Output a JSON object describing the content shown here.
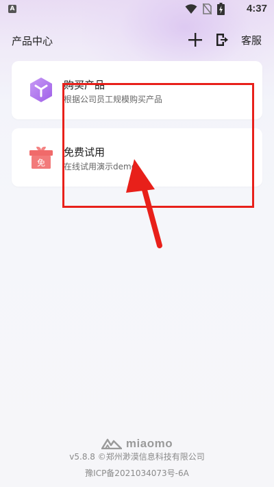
{
  "status_bar": {
    "app_icon_letter": "A",
    "time": "4:37"
  },
  "header": {
    "title": "产品中心",
    "service_label": "客服"
  },
  "cards": [
    {
      "title": "购买产品",
      "description": "根据公司员工规模购买产品",
      "icon": "cube-icon",
      "icon_color": "#b67ff0"
    },
    {
      "title": "免费试用",
      "description": "在线试用演示demo",
      "icon": "gift-icon",
      "icon_text": "免",
      "icon_color": "#f06a6a"
    }
  ],
  "annotation": {
    "color": "#e8201a"
  },
  "footer": {
    "logo_text": "miaomo",
    "version_line": "v5.8.8 ©郑州渺漠信息科技有限公司",
    "icp_line": "豫ICP备2021034073号-6A"
  }
}
